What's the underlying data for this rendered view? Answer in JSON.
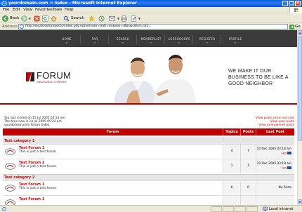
{
  "window": {
    "title": "yourdomain.com :: Index - Microsoft Internet Explorer",
    "minimize_glyph": "_",
    "maximize_glyph": "□",
    "close_glyph": "×"
  },
  "menu": [
    "File",
    "Edit",
    "View",
    "Favorites",
    "Tools",
    "Help"
  ],
  "toolbar": {
    "back_label": "Back",
    "search_label": "Search"
  },
  "address": {
    "label": "Address",
    "url": "http://localhost/projects/index.php?advertiser=eaff=en&ses=dfbs&sdfsd=5f5...",
    "go_label": "Go"
  },
  "site_nav": [
    "HOME",
    "FAQ",
    "SEARCH",
    "MEMBERLIST",
    "USERGROUPS",
    "REGISTER",
    "PROFILE"
  ],
  "banner": {
    "logo_name": "FORUM",
    "logo_tagline": "INSURANCE COMPANY",
    "slogan_lines": [
      "WE MAKE IT OUR",
      "BUSINESS TO BE LIKE A",
      "GOOD NEIGHBOR"
    ]
  },
  "info": {
    "last_visit": "You last visited on 15 Jul 2005 05:14 am",
    "current_time": "The time now is 14 Jul 2005 05:24 am",
    "index_link": "yourdomain.com Forum Index",
    "right_links": [
      "View posts since last visit",
      "View your posts",
      "View unanswered posts"
    ]
  },
  "table": {
    "headers": {
      "forum": "Forum",
      "topics": "Topics",
      "posts": "Posts",
      "last_post": "Last Post"
    },
    "categories": [
      {
        "name": "Test category 1",
        "forums": [
          {
            "name": "Test Forum 1",
            "desc": "This is just a test forum.",
            "topics": "4",
            "posts": "7",
            "last_date": "10 Dec 2005 03:18 am",
            "last_by": "seo"
          },
          {
            "name": "Test Forum 2",
            "desc": "This is just a test forum.",
            "topics": "1",
            "posts": "1",
            "last_date": "10 Dec 2005 03:19 am",
            "last_by": "seo"
          }
        ]
      },
      {
        "name": "Test category 2",
        "forums": [
          {
            "name": "Test Forum 1",
            "desc": "This is just a test forum.",
            "topics": "0",
            "posts": "0",
            "last_date": "No Posts",
            "last_by": ""
          },
          {
            "name": "Test Forum 2",
            "desc": "",
            "topics": "",
            "posts": "",
            "last_date": "",
            "last_by": ""
          }
        ]
      }
    ]
  },
  "status": {
    "zone": "Local intranet"
  },
  "colors": {
    "accent_red": "#c00000",
    "nav_bg": "#3b3b3b",
    "xp_blue": "#0a5ee0"
  }
}
